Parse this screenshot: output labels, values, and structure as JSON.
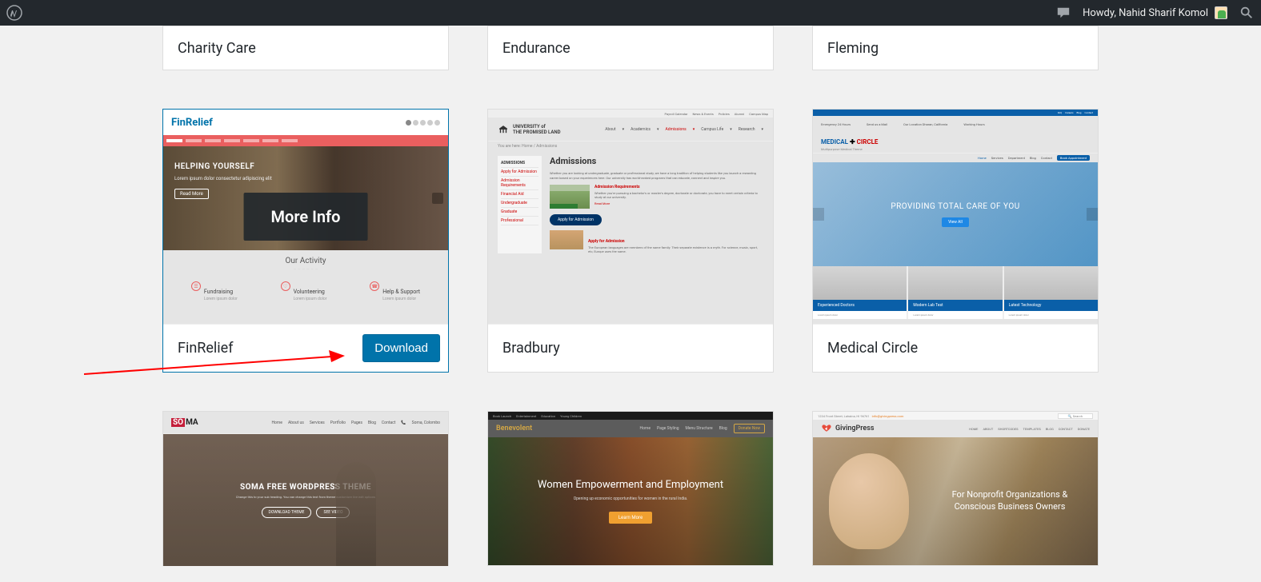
{
  "admin_bar": {
    "greeting": "Howdy, Nahid Sharif Komol"
  },
  "hover_card": {
    "more_info_label": "More Info",
    "download_label": "Download"
  },
  "row1": [
    {
      "title": "Charity Care"
    },
    {
      "title": "Endurance"
    },
    {
      "title": "Fleming"
    }
  ],
  "row2": [
    {
      "title": "FinRelief",
      "active": true,
      "download": true
    },
    {
      "title": "Bradbury"
    },
    {
      "title": "Medical Circle"
    }
  ],
  "finrelief": {
    "logo": "FinRelief",
    "hero_heading": "HELPING YOURSELF",
    "hero_btn": "Read More",
    "activity_title": "Our Activity",
    "cols": [
      {
        "label": "Fundraising"
      },
      {
        "label": "Volunteering"
      },
      {
        "label": "Help & Support"
      }
    ]
  },
  "bradbury": {
    "top_links": [
      "Payroll Calendar",
      "News & Events",
      "Policies",
      "Alumni",
      "Campus Map"
    ],
    "university_line1": "UNIVERSITY of",
    "university_line2": "THE PROMISED LAND",
    "nav": [
      "About",
      "Academics",
      "Admissions",
      "Campus Life",
      "Research"
    ],
    "crumb": "You are here: Home / Admissions",
    "sidebar_head": "ADMISSIONS",
    "sidebar": [
      "Apply for Admission",
      "Admission Requirements",
      "Financial Aid",
      "Undergraduate",
      "Graduate",
      "Professional"
    ],
    "main_heading": "Admissions",
    "main_p": "Whether you are looking at undergraduate, graduate or professional study, we have a long tradition of helping students like you launch a rewarding career based on your experiences here. Our university has world-ranked programs that can educate, connect and inspire you.",
    "req_title": "Admission Requirements",
    "req_text": "Whether you're pursuing a bachelor's or master's degree, doctorate or doctorate, you have to meet certain criteria to study at our university.",
    "read_more": "Read More",
    "apply_btn": "Apply for Admission",
    "apply_title": "Apply for Admission",
    "apply_text": "The European languages are members of the same family. Their separate existence is a myth. For science, music, sport, etc, Europe uses the same."
  },
  "medical": {
    "logo_part1": "MEDICAL",
    "logo_part2": "CIRCLE",
    "tagline": "Multipurpose Medical Theme",
    "info_items": [
      "Emergency 24 Hours",
      "Send us a Mail",
      "Our Location Dharan, California",
      "Working Hours"
    ],
    "nav": [
      "Home",
      "Services",
      "Department",
      "Blog",
      "Contact"
    ],
    "nav_btn": "Book Appointment",
    "hero_heading": "PROVIDING TOTAL CARE OF YOU",
    "hero_btn": "View All",
    "cards": [
      {
        "label": "Experienced Doctors"
      },
      {
        "label": "Modern Lab Test"
      },
      {
        "label": "Latest Technology"
      }
    ]
  },
  "soma": {
    "logo_s": "SO",
    "logo_rest": "MA",
    "nav": [
      "Home",
      "About us",
      "Services",
      "Portfolio",
      "Pages",
      "Blog",
      "Contact"
    ],
    "right_info": "Soma, Colombo",
    "hero_heading": "SOMA FREE WORDPRESS THEME",
    "hero_sub": "Change this to your sub heading. You can change this text from theme customizer live edit options",
    "btn1": "DOWNLOAD THEME",
    "btn2": "SEE VIDEO"
  },
  "benevolent": {
    "top": [
      "Book Launch",
      "Entertainment",
      "Education",
      "Young Children"
    ],
    "logo": "Benevolent",
    "nav": [
      "Home",
      "Page Styling",
      "Menu Structure",
      "Blog"
    ],
    "donate": "Donate Now",
    "hero_heading": "Women Empowerment and Employment",
    "hero_sub": "Opening up economic opportunities for women in the rural India.",
    "btn": "Learn More"
  },
  "giving": {
    "top_left": "1234 Front Street, Lahaina, HI 96761",
    "top_email": "info@givingpress.com",
    "top_search": "Search",
    "logo": "GivingPress",
    "nav": [
      "HOME",
      "ABOUT",
      "SHORTCODES",
      "TEMPLATES",
      "BLOG",
      "CONTACT",
      "DONATE"
    ],
    "hero_heading": "For Nonprofit Organizations & Conscious Business Owners"
  }
}
